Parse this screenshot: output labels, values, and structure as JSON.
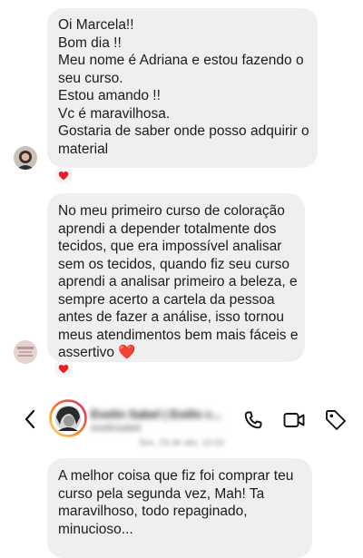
{
  "messages": [
    {
      "lines": [
        "Oi Marcela!!",
        "Bom dia !!",
        "Meu nome é Adriana e estou fazendo o",
        "seu curso.",
        "Estou amando !!",
        "Vc é maravilhosa.",
        "Gostaria de saber onde posso adquirir o",
        "material"
      ],
      "reaction": "heart"
    },
    {
      "lines": [
        "No meu primeiro curso de coloração",
        "aprendi a depender totalmente dos",
        "tecidos, que era impossível analisar",
        "sem os tecidos, quando fiz seu curso",
        "aprendi a analisar primeiro a beleza, e",
        "sempre acerto a cartela da pessoa",
        "antes de fazer a análise, isso tornou",
        "meus atendimentos bem mais fáceis e",
        "assertivo ❤️"
      ],
      "reaction": "heart"
    },
    {
      "lines": [
        "A melhor coisa que fiz foi comprar teu",
        "curso pela segunda vez, Mah! Ta",
        "maravilhoso, todo repaginado,",
        "minucioso..."
      ]
    }
  ],
  "chat_header": {
    "name": "Evelin Sabel | Estilo c...",
    "username": "evelinsabel",
    "date": "Sex, 23 de abr, 10:02"
  },
  "icons": {
    "back": "chevron-left-icon",
    "call": "phone-icon",
    "video": "video-camera-icon",
    "tag": "tag-icon",
    "reaction": "heart-icon"
  },
  "colors": {
    "bubble": "#efefef",
    "heart": "#ed1c24",
    "story_ring_start": "#feda75",
    "story_ring_end": "#d62976"
  }
}
